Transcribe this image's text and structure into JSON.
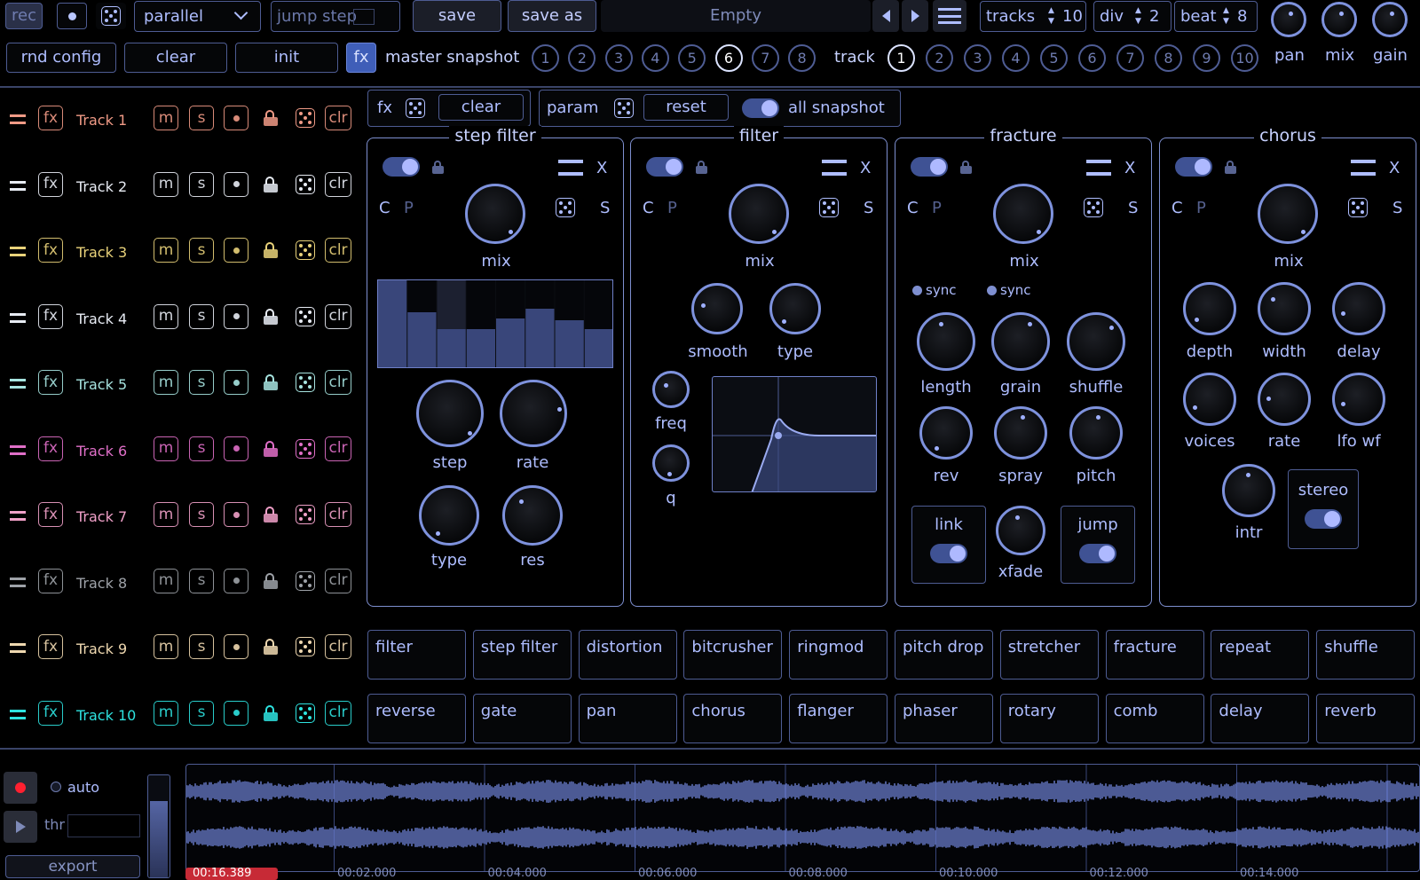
{
  "topbar": {
    "rec": "rec",
    "mode": "parallel",
    "jump_step": "jump step",
    "save": "save",
    "save_as": "save as",
    "preset_name": "Empty",
    "tracks_label": "tracks",
    "tracks_value": "10",
    "div_label": "div",
    "div_value": "2",
    "beat_label": "beat",
    "beat_value": "8",
    "pan": "pan",
    "mix": "mix",
    "gain": "gain"
  },
  "row2": {
    "rnd_config": "rnd config",
    "clear": "clear",
    "init": "init",
    "fx": "fx",
    "master_snapshot": "master snapshot",
    "master_numbers": [
      "1",
      "2",
      "3",
      "4",
      "5",
      "6",
      "7",
      "8"
    ],
    "master_selected": 6,
    "track": "track",
    "track_numbers": [
      "1",
      "2",
      "3",
      "4",
      "5",
      "6",
      "7",
      "8",
      "9",
      "10"
    ],
    "track_selected": 1
  },
  "tracks": [
    {
      "name": "Track 1",
      "color": "#f09a86"
    },
    {
      "name": "Track 2",
      "color": "#e8ecf4"
    },
    {
      "name": "Track 3",
      "color": "#e9d27a"
    },
    {
      "name": "Track 4",
      "color": "#e8ecf4"
    },
    {
      "name": "Track 5",
      "color": "#a7e4e0"
    },
    {
      "name": "Track 6",
      "color": "#e06fc8"
    },
    {
      "name": "Track 7",
      "color": "#f0a0c8"
    },
    {
      "name": "Track 8",
      "color": "#9ea2a8"
    },
    {
      "name": "Track 9",
      "color": "#efd8b0"
    },
    {
      "name": "Track 10",
      "color": "#2ee3e0"
    }
  ],
  "track_buttons": {
    "fx": "fx",
    "m": "m",
    "s": "s",
    "clr": "clr"
  },
  "fxbar": {
    "fx": "fx",
    "clear": "clear",
    "param": "param",
    "reset": "reset",
    "all_snapshot": "all snapshot"
  },
  "panels": {
    "step_filter": {
      "title": "step filter",
      "c": "C",
      "p": "P",
      "x": "X",
      "s": "S",
      "mix": "mix",
      "step": "step",
      "rate": "rate",
      "type": "type",
      "res": "res",
      "steps": [
        1.0,
        0.64,
        0.45,
        0.45,
        0.57,
        0.68,
        0.55,
        0.45
      ]
    },
    "filter": {
      "title": "filter",
      "c": "C",
      "p": "P",
      "x": "X",
      "s": "S",
      "mix": "mix",
      "smooth": "smooth",
      "type": "type",
      "freq": "freq",
      "q": "q"
    },
    "fracture": {
      "title": "fracture",
      "c": "C",
      "p": "P",
      "x": "X",
      "s": "S",
      "mix": "mix",
      "sync": "sync",
      "length": "length",
      "grain": "grain",
      "shuffle": "shuffle",
      "rev": "rev",
      "spray": "spray",
      "pitch": "pitch",
      "link": "link",
      "xfade": "xfade",
      "jump": "jump"
    },
    "chorus": {
      "title": "chorus",
      "c": "C",
      "p": "P",
      "x": "X",
      "s": "S",
      "mix": "mix",
      "depth": "depth",
      "width": "width",
      "delay": "delay",
      "voices": "voices",
      "rate": "rate",
      "lfo_wf": "lfo wf",
      "intr": "intr",
      "stereo": "stereo"
    }
  },
  "fx_list": [
    "filter",
    "step filter",
    "distortion",
    "bitcrusher",
    "ringmod",
    "pitch drop",
    "stretcher",
    "fracture",
    "repeat",
    "shuffle",
    "reverse",
    "gate",
    "pan",
    "chorus",
    "flanger",
    "phaser",
    "rotary",
    "comb",
    "delay",
    "reverb"
  ],
  "bottom": {
    "auto": "auto",
    "thr": "thr",
    "export": "export",
    "time": "00:16.389",
    "times": [
      "00:02.000",
      "00:04.000",
      "00:06.000",
      "00:08.000",
      "00:10.000",
      "00:12.000",
      "00:14.000"
    ]
  }
}
